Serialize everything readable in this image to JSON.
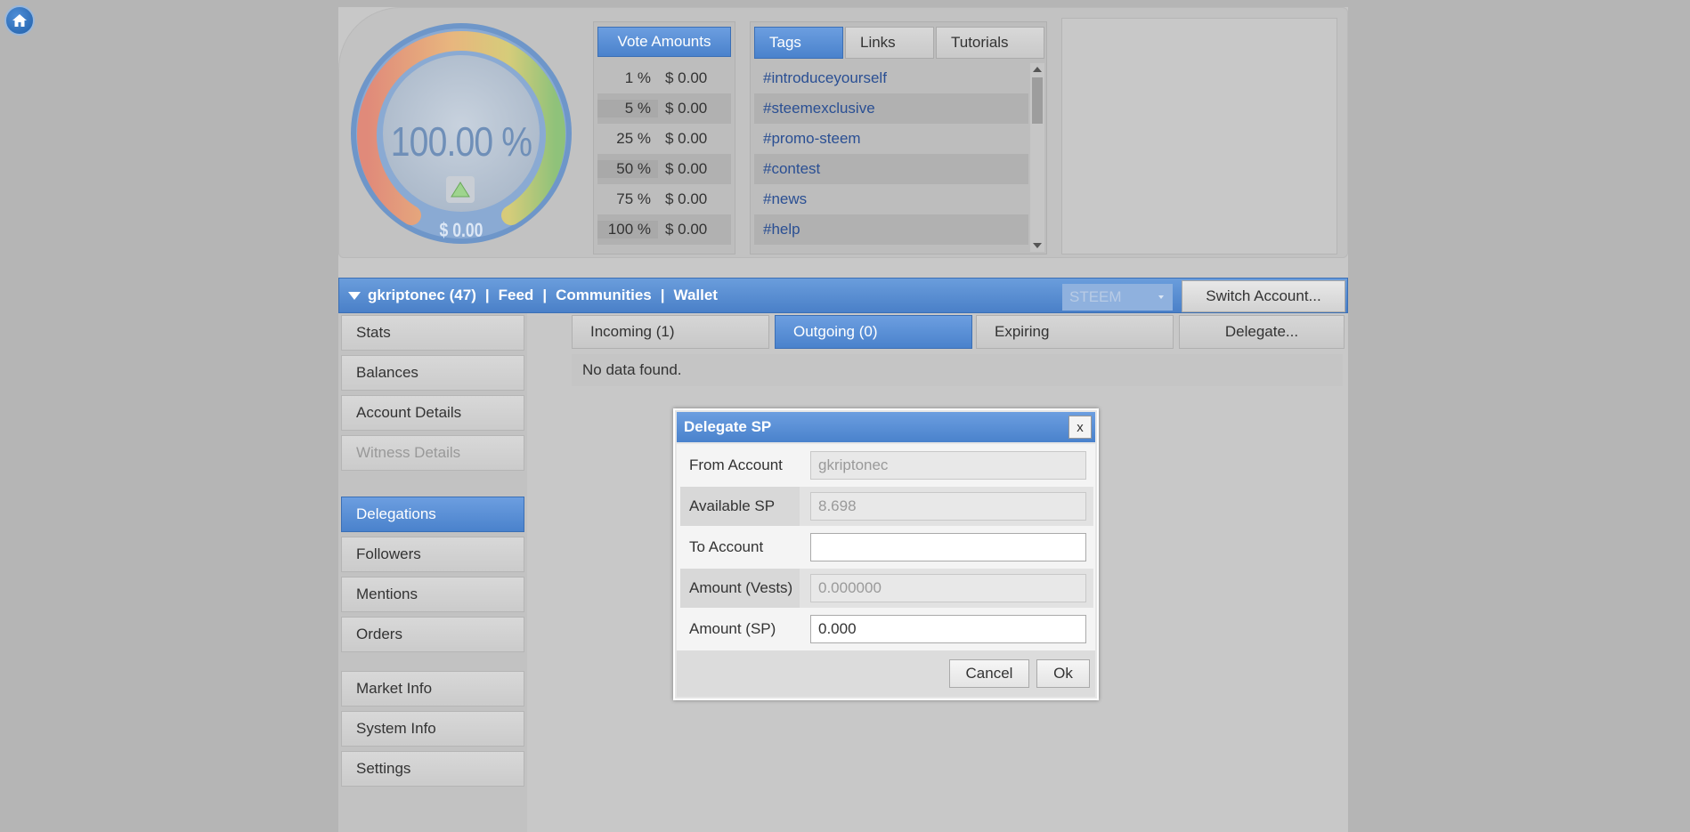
{
  "gauge": {
    "percent_text": "100.00 %",
    "dollar_text": "$ 0.00"
  },
  "vote_amounts": {
    "title": "Vote Amounts",
    "rows": [
      {
        "pct": "1 %",
        "amount": "$ 0.00"
      },
      {
        "pct": "5 %",
        "amount": "$ 0.00"
      },
      {
        "pct": "25 %",
        "amount": "$ 0.00"
      },
      {
        "pct": "50 %",
        "amount": "$ 0.00"
      },
      {
        "pct": "75 %",
        "amount": "$ 0.00"
      },
      {
        "pct": "100 %",
        "amount": "$ 0.00"
      }
    ]
  },
  "tag_tabs": [
    "Tags",
    "Links",
    "Tutorials"
  ],
  "tags": [
    "#introduceyourself",
    "#steemexclusive",
    "#promo-steem",
    "#contest",
    "#news",
    "#help"
  ],
  "nav": {
    "account": "gkriptonec (47)",
    "links": [
      "Feed",
      "Communities",
      "Wallet"
    ],
    "separator": "|",
    "coin": "STEEM",
    "switch_label": "Switch Account..."
  },
  "sidebar": {
    "items": [
      "Stats",
      "Balances",
      "Account Details",
      "Witness Details",
      "Delegations",
      "Followers",
      "Mentions",
      "Orders",
      "Market Info",
      "System Info",
      "Settings"
    ]
  },
  "delegation_tabs": [
    "Incoming (1)",
    "Outgoing (0)",
    "Expiring",
    "Delegate..."
  ],
  "no_data": "No data found.",
  "dialog": {
    "title": "Delegate SP",
    "close": "x",
    "from_label": "From Account",
    "from_value": "gkriptonec",
    "available_label": "Available SP",
    "available_value": "8.698",
    "to_label": "To Account",
    "to_value": "",
    "vests_label": "Amount (Vests)",
    "vests_value": "0.000000",
    "sp_label": "Amount (SP)",
    "sp_value": "0.000",
    "cancel": "Cancel",
    "ok": "Ok"
  },
  "colors": {
    "accent": "#4a82cc",
    "background": "#b5b5b5",
    "tag_link": "#2a4f93"
  }
}
